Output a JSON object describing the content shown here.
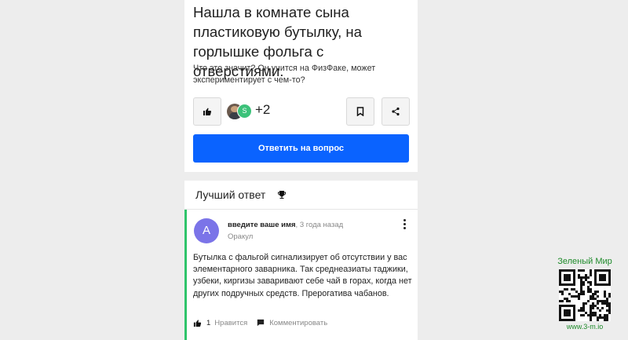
{
  "question": {
    "title": "Нашла в комнате сына пластиковую бутылку, на горлышке фольга с отверстиями.",
    "body": "Что это значит? Он учится на ФизФаке, может экспериментирует с чем-то?",
    "avatar_letter": "S",
    "extra_count": "+2",
    "answer_button": "Ответить на вопрос"
  },
  "best_answer": {
    "header": "Лучший ответ",
    "avatar_letter": "A",
    "username": "введите ваше имя",
    "time": ", 3 года назад",
    "role": "Оракул",
    "text": "Бутылка с фальгой сигнализирует об отсутствии у вас элементарного заварника. Так среднеазиаты таджики, узбеки, киргизы заваривают себе чай в горах, когда нет других подручных средств. Прерогатива чабанов.",
    "likes": "1",
    "like_label": "Нравится",
    "comment_label": "Комментировать"
  },
  "watermark": {
    "title": "Зеленый Мир",
    "url": "www.3-m.io"
  },
  "colors": {
    "primary": "#0a63ff",
    "accent_green": "#2fc46a",
    "avatar_purple": "#7b74e8",
    "watermark_green": "#1e8a2a"
  },
  "icons": [
    "thumbs-up-icon",
    "bookmark-icon",
    "share-icon",
    "trophy-icon",
    "kebab-menu-icon",
    "comment-icon",
    "qr-code"
  ]
}
